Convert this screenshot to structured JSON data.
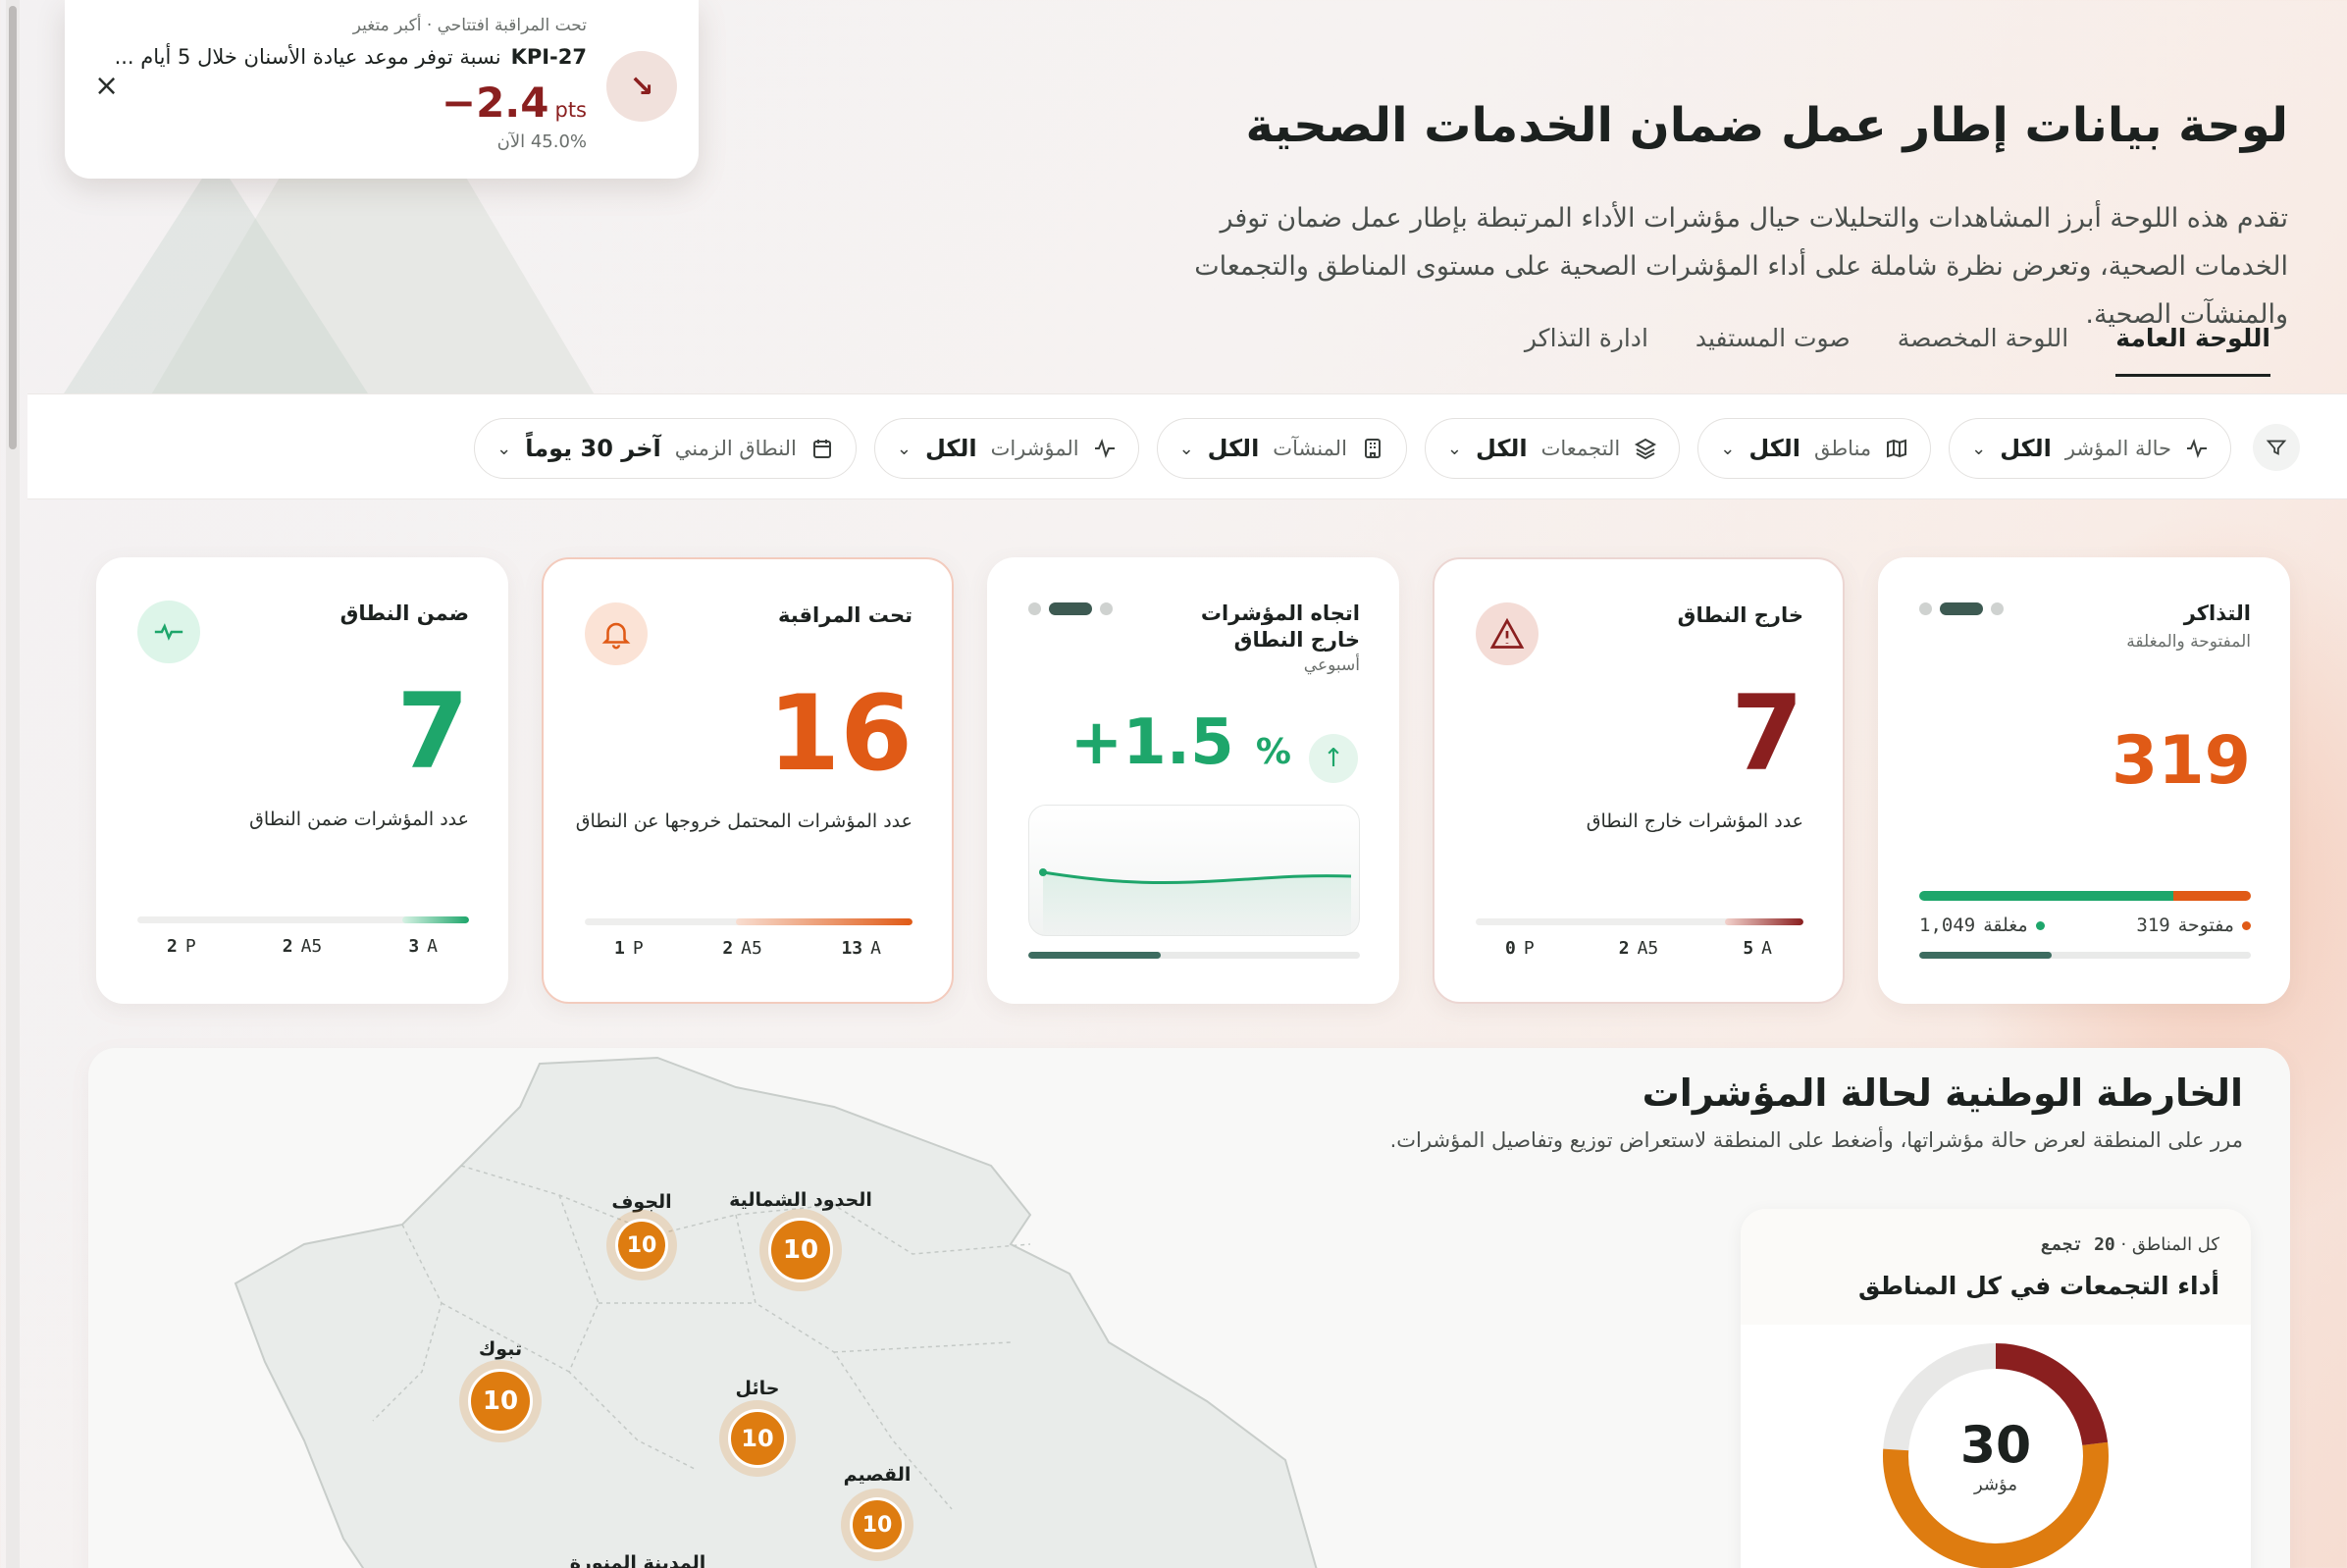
{
  "header": {
    "title": "لوحة بيانات إطار عمل ضمان الخدمات الصحية",
    "description": "تقدم هذه اللوحة أبرز المشاهدات والتحليلات حيال مؤشرات الأداء المرتبطة بإطار عمل ضمان توفر الخدمات الصحية، وتعرض نظرة شاملة على أداء المؤشرات الصحية على مستوى المناطق والتجمعات والمنشآت الصحية."
  },
  "tabs": [
    {
      "label": "اللوحة العامة",
      "active": true
    },
    {
      "label": "اللوحة المخصصة",
      "active": false
    },
    {
      "label": "صوت المستفيد",
      "active": false
    },
    {
      "label": "ادارة التذاكر",
      "active": false
    }
  ],
  "filters": [
    {
      "label": "حالة المؤشر",
      "value": "الكل",
      "icon": "pulse-icon"
    },
    {
      "label": "مناطق",
      "value": "الكل",
      "icon": "map-icon"
    },
    {
      "label": "التجمعات",
      "value": "الكل",
      "icon": "layers-icon"
    },
    {
      "label": "المنشآت",
      "value": "الكل",
      "icon": "building-icon"
    },
    {
      "label": "المؤشرات",
      "value": "الكل",
      "icon": "pulse-icon"
    },
    {
      "label": "النطاق الزمني",
      "value": "آخر 30 يوماً",
      "icon": "calendar-icon"
    }
  ],
  "cards": {
    "tickets": {
      "title": "التذاكر",
      "subtitle": "المفتوحة والمغلقة",
      "value": "319",
      "open_label": "مفتوحة",
      "open_value": "319",
      "closed_label": "مغلقة",
      "closed_value": "1,049",
      "open_color": "#e05a16",
      "closed_color": "#1ea66b"
    },
    "out_of_range": {
      "title": "خارج النطاق",
      "value": "7",
      "desc": "عدد المؤشرات خارج النطاق",
      "color": "#8a1f1f",
      "legend": [
        {
          "k": "A",
          "v": "5"
        },
        {
          "k": "A5",
          "v": "2"
        },
        {
          "k": "P",
          "v": "0"
        }
      ]
    },
    "trend": {
      "title": "اتجاه المؤشرات خارج النطاق",
      "subtitle": "أسبوعي",
      "value": "+1.5",
      "unit": "%"
    },
    "watch": {
      "title": "تحت المراقبة",
      "value": "16",
      "desc": "عدد المؤشرات المحتمل خروجها عن النطاق",
      "color": "#e05a16",
      "legend": [
        {
          "k": "A",
          "v": "13"
        },
        {
          "k": "A5",
          "v": "2"
        },
        {
          "k": "P",
          "v": "1"
        }
      ]
    },
    "in_range": {
      "title": "ضمن النطاق",
      "value": "7",
      "desc": "عدد المؤشرات ضمن النطاق",
      "color": "#1ea66b",
      "legend": [
        {
          "k": "A",
          "v": "3"
        },
        {
          "k": "A5",
          "v": "2"
        },
        {
          "k": "P",
          "v": "2"
        }
      ]
    }
  },
  "map": {
    "title": "الخارطة الوطنية لحالة المؤشرات",
    "subtitle": "مرر على المنطقة لعرض حالة مؤشراتها، وأضغط على المنطقة لاستعراض توزيع وتفاصيل المؤشرات.",
    "regions": [
      {
        "name": "الحدود الشمالية",
        "count": "10"
      },
      {
        "name": "الجوف",
        "count": "10"
      },
      {
        "name": "تبوك",
        "count": "10"
      },
      {
        "name": "حائل",
        "count": "10"
      },
      {
        "name": "القصيم",
        "count": "10"
      },
      {
        "name": "المدينة المنورة",
        "count": ""
      }
    ],
    "pin_color": "#de7c10"
  },
  "donut": {
    "meta_scope": "كل المناطق",
    "meta_count": "20 تجمع",
    "title": "أداء التجمعات في كل المناطق",
    "center_value": "30",
    "center_unit": "مؤشر",
    "colors": {
      "out": "#8a1f1f",
      "watch": "#de7c10",
      "rest": "#e8e8e7"
    }
  },
  "toast": {
    "meta": "تحت المراقبة افتتاحي · أكبر متغير",
    "kpi_id": "KPI-27",
    "kpi_name": "نسبة توفر موعد عيادة الأسنان خلال 5 أيام ...",
    "delta": "−2.4",
    "delta_unit": "pts",
    "now": "45.0% الآن"
  }
}
